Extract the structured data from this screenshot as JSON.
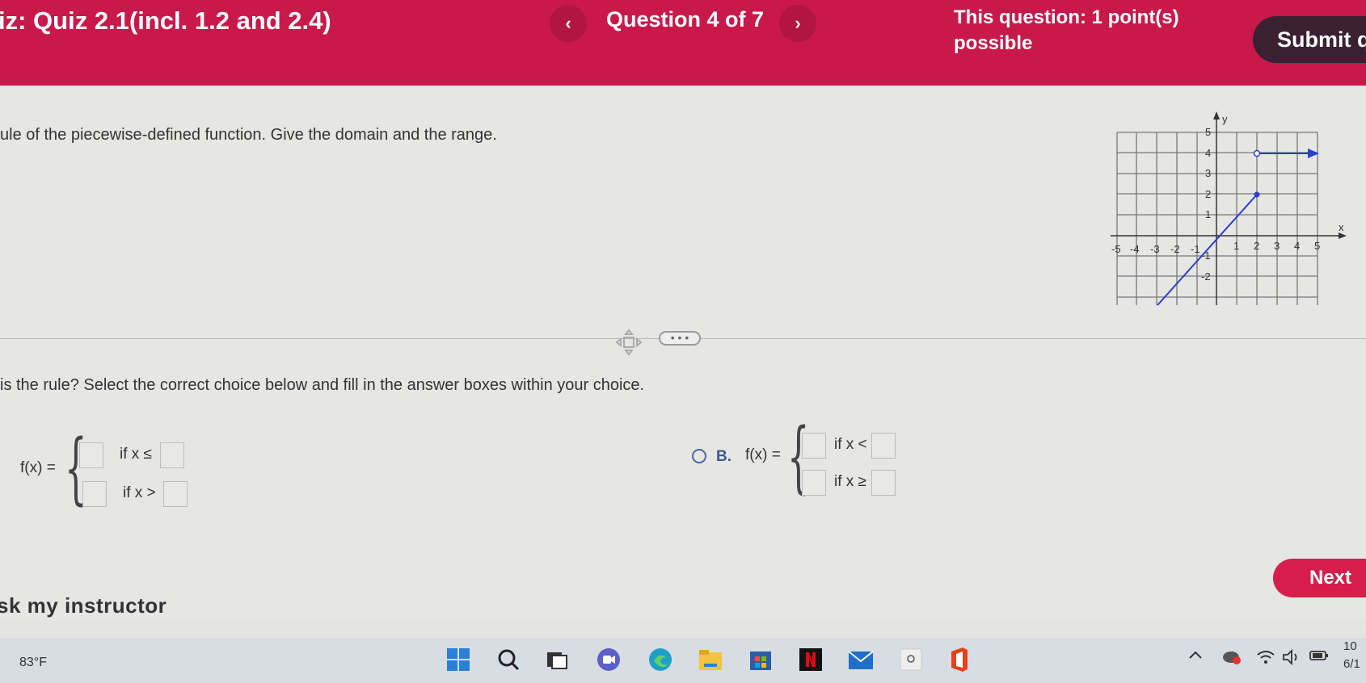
{
  "header": {
    "quiz_title": "iz:  Quiz 2.1(incl. 1.2 and 2.4)",
    "prev_label": "‹",
    "question_of": "Question 4 of 7",
    "next_label": "›",
    "points": "This question: 1 point(s) possible",
    "submit_label": "Submit q"
  },
  "content": {
    "instruction": "ule of the piecewise-defined function. Give the domain and the range.",
    "graph": {
      "x_axis_label": "x",
      "y_axis_label": "y",
      "x_ticks": [
        "-5",
        "-4",
        "-3",
        "-2",
        "-1",
        "1",
        "2",
        "3",
        "4",
        "5"
      ],
      "y_ticks": [
        "5",
        "4",
        "3",
        "2",
        "1",
        "-1",
        "-2"
      ]
    },
    "more_label": "• • •",
    "question": "is the rule? Select the correct choice below and fill in the answer boxes within your choice.",
    "choice_a": {
      "fx_label": "f(x) =",
      "cond1": "if x ≤",
      "cond2": "if x >"
    },
    "choice_b": {
      "letter": "B.",
      "fx_label": "f(x) =",
      "cond1": "if x <",
      "cond2": "if x ≥"
    },
    "next_label": "Next",
    "ask_instructor": "sk my instructor"
  },
  "taskbar": {
    "weather": "83°F",
    "clock_line1": "10",
    "clock_line2": "6/1"
  }
}
